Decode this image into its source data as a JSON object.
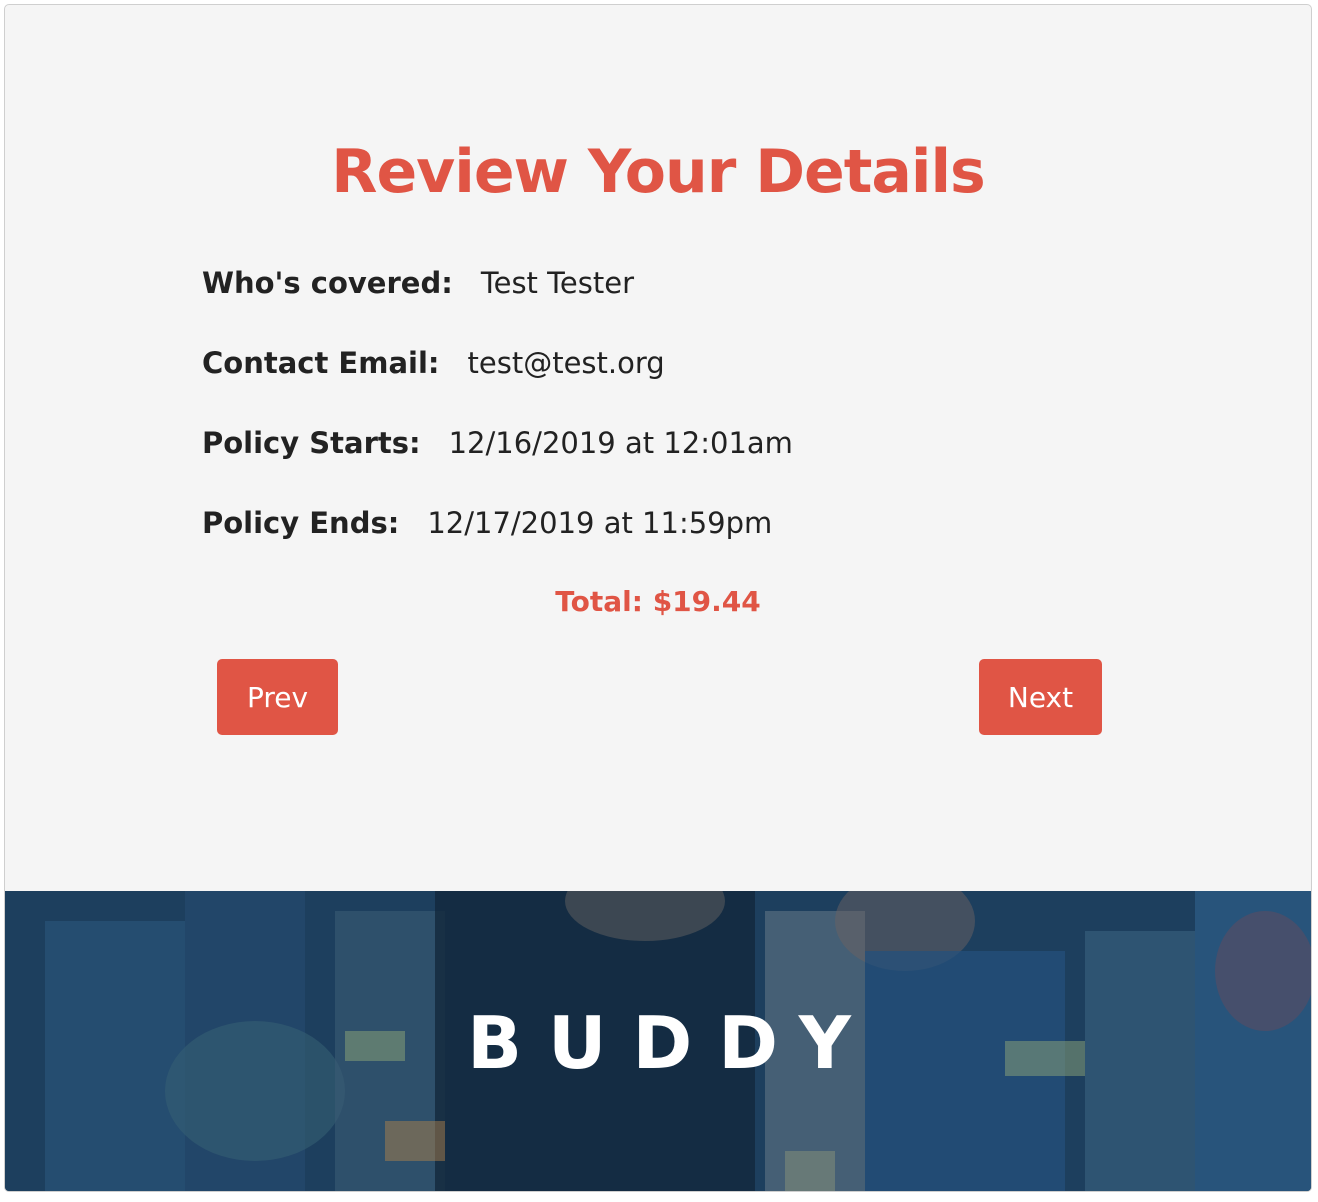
{
  "page": {
    "title": "Review Your Details"
  },
  "details": [
    {
      "label": "Who's covered:",
      "value": "Test Tester"
    },
    {
      "label": "Contact Email:",
      "value": "test@test.org"
    },
    {
      "label": "Policy Starts:",
      "value": "12/16/2019 at 12:01am"
    },
    {
      "label": "Policy Ends:",
      "value": "12/17/2019 at 11:59pm"
    }
  ],
  "total": "Total: $19.44",
  "buttons": {
    "prev": "Prev",
    "next": "Next"
  },
  "footer": {
    "brand": "BUDDY"
  },
  "colors": {
    "accent": "#e05545",
    "card_background": "#f5f5f5",
    "footer_overlay": "#1e4060"
  }
}
